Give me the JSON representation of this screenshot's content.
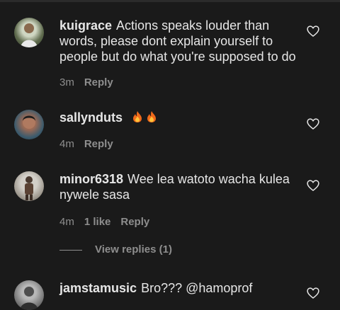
{
  "colors": {
    "background": "#1a1a1a",
    "text": "#e6e6e6",
    "muted": "#8e8e8e"
  },
  "comments": [
    {
      "username": "kuigrace",
      "text": "Actions speaks louder than words, please dont explain yourself to people but do what you're supposed to do",
      "time": "3m",
      "likes": "",
      "reply": "Reply",
      "icon": "heart-outline-icon"
    },
    {
      "username": "sallynduts",
      "text": "",
      "emoji": [
        "fire-emoji",
        "fire-emoji"
      ],
      "time": "4m",
      "likes": "",
      "reply": "Reply",
      "icon": "heart-outline-icon"
    },
    {
      "username": "minor6318",
      "text": "Wee lea watoto wacha kulea nywele sasa",
      "time": "4m",
      "likes": "1 like",
      "reply": "Reply",
      "view_replies": "View replies (1)",
      "icon": "heart-outline-icon"
    },
    {
      "username": "jamstamusic",
      "text": "Bro??? @hamoprof",
      "icon": "heart-outline-icon"
    }
  ]
}
